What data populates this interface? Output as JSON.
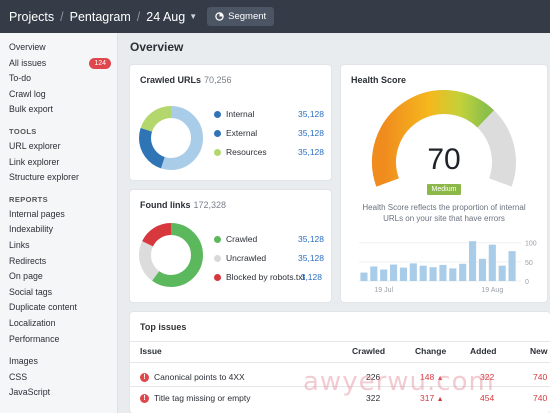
{
  "topbar": {
    "crumb_projects": "Projects",
    "crumb_project": "Pentagram",
    "crumb_date": "24 Aug",
    "segment_label": "Segment"
  },
  "sidebar": {
    "items_top": [
      {
        "label": "Overview"
      },
      {
        "label": "All issues",
        "badge": "124"
      },
      {
        "label": "To-do"
      },
      {
        "label": "Crawl log"
      },
      {
        "label": "Bulk export"
      }
    ],
    "tools_heading": "TOOLS",
    "tools": [
      {
        "label": "URL explorer"
      },
      {
        "label": "Link explorer"
      },
      {
        "label": "Structure explorer"
      }
    ],
    "reports_heading": "REPORTS",
    "reports": [
      {
        "label": "Internal pages"
      },
      {
        "label": "Indexability"
      },
      {
        "label": "Links"
      },
      {
        "label": "Redirects"
      },
      {
        "label": "On page"
      },
      {
        "label": "Social tags"
      },
      {
        "label": "Duplicate content"
      },
      {
        "label": "Localization"
      },
      {
        "label": "Performance"
      }
    ],
    "resources": [
      {
        "label": "Images"
      },
      {
        "label": "CSS"
      },
      {
        "label": "JavaScript"
      }
    ]
  },
  "main": {
    "title": "Overview"
  },
  "crawled_urls": {
    "title": "Crawled URLs",
    "count": "70,256",
    "rows": [
      {
        "label": "Internal",
        "value": "35,128",
        "color": "#2f74b5"
      },
      {
        "label": "External",
        "value": "35,128",
        "color": "#2f74b5"
      },
      {
        "label": "Resources",
        "value": "35,128",
        "color": "#b3d76d"
      }
    ],
    "donut": [
      {
        "value": 55,
        "color": "#a9cce8"
      },
      {
        "value": 25,
        "color": "#2f74b5"
      },
      {
        "value": 20,
        "color": "#b3d76d"
      }
    ]
  },
  "found_links": {
    "title": "Found links",
    "count": "172,328",
    "rows": [
      {
        "label": "Crawled",
        "value": "35,128",
        "color": "#5cb85c"
      },
      {
        "label": "Uncrawled",
        "value": "35,128",
        "color": "#d9d9d9"
      },
      {
        "label": "Blocked by robots.txt",
        "value": "3,128",
        "color": "#d6383d"
      }
    ],
    "donut": [
      {
        "value": 60,
        "color": "#5cb85c"
      },
      {
        "value": 22,
        "color": "#dcdcdc"
      },
      {
        "value": 18,
        "color": "#d6383d"
      }
    ]
  },
  "health": {
    "title": "Health Score",
    "score": "70",
    "grade": "Medium",
    "description_line1": "Health Score reflects the proportion of internal",
    "description_line2": "URLs on your site that have errors",
    "gauge_fraction": 0.7
  },
  "chart_data": {
    "type": "bar",
    "x_ticks": [
      "19 Jul",
      "19 Aug"
    ],
    "values": [
      22,
      38,
      30,
      43,
      35,
      46,
      40,
      36,
      42,
      33,
      45,
      104,
      58,
      95,
      40,
      78
    ],
    "yticks": [
      "100",
      "50",
      "0"
    ],
    "ylim": [
      0,
      115
    ],
    "color": "#a9cce8"
  },
  "issues": {
    "title": "Top issues",
    "headers": {
      "issue": "Issue",
      "crawled": "Crawled",
      "change": "Change",
      "added": "Added",
      "new": "New"
    },
    "rows": [
      {
        "issue": "Canonical points to 4XX",
        "crawled": "226",
        "change": "148",
        "added": "322",
        "new": "740"
      },
      {
        "issue": "Title tag missing or empty",
        "crawled": "322",
        "change": "317",
        "added": "454",
        "new": "740"
      }
    ]
  },
  "watermark": "awyerwu.com"
}
